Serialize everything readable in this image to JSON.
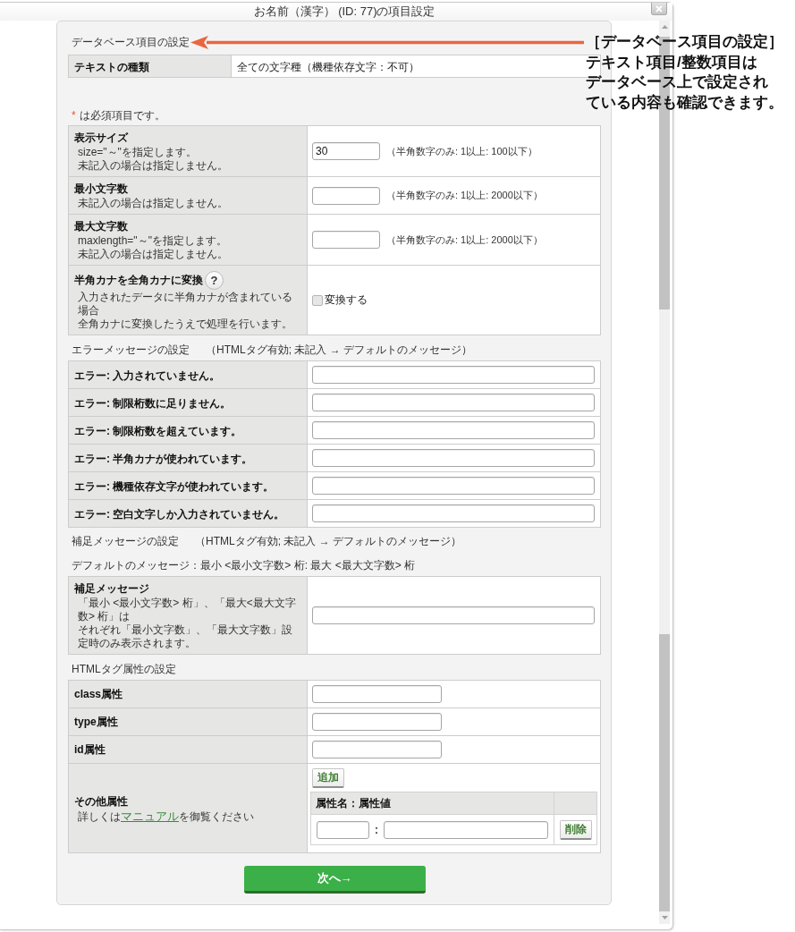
{
  "window": {
    "title": "お名前（漢字） (ID: 77)の項目設定"
  },
  "database_section": {
    "heading": "データベース項目の設定",
    "rows": [
      {
        "label": "テキストの種類",
        "value": "全ての文字種（機種依存文字：不可）"
      }
    ]
  },
  "required_note": {
    "mark": "*",
    "text": "は必須項目です。"
  },
  "size_settings": {
    "rows": [
      {
        "kind": "text",
        "label": "表示サイズ",
        "notes": [
          "size=\"～\"を指定します。",
          "未記入の場合は指定しません。"
        ],
        "value": "30",
        "hint": "（半角数字のみ: 1以上: 100以下）"
      },
      {
        "kind": "text",
        "label": "最小文字数",
        "notes": [
          "未記入の場合は指定しません。"
        ],
        "hint": "（半角数字のみ: 1以上: 2000以下）"
      },
      {
        "kind": "text",
        "label": "最大文字数",
        "notes": [
          "maxlength=\"～\"を指定します。",
          "未記入の場合は指定しません。"
        ],
        "hint": "（半角数字のみ: 1以上: 2000以下）"
      },
      {
        "kind": "checkbox",
        "label": "半角カナを全角カナに変換",
        "help": "?",
        "notes": [
          "入力されたデータに半角カナが含まれている場合",
          "全角カナに変換したうえで処理を行います。"
        ],
        "option": "変換する",
        "checked": false
      }
    ]
  },
  "error_section": {
    "heading": "エラーメッセージの設定",
    "note": "（HTMLタグ有効; 未記入 → デフォルトのメッセージ）",
    "rows": [
      {
        "label": "エラー: 入力されていません。"
      },
      {
        "label": "エラー: 制限桁数に足りません。"
      },
      {
        "label": "エラー: 制限桁数を超えています。"
      },
      {
        "label": "エラー: 半角カナが使われています。"
      },
      {
        "label": "エラー: 機種依存文字が使われています。"
      },
      {
        "label": "エラー: 空白文字しか入力されていません。"
      }
    ]
  },
  "supplement_section": {
    "heading": "補足メッセージの設定",
    "note": "（HTMLタグ有効; 未記入 → デフォルトのメッセージ）",
    "default_message": "デフォルトのメッセージ：最小 <最小文字数> 桁: 最大 <最大文字数> 桁",
    "rows": [
      {
        "label": "補足メッセージ",
        "notes": [
          "「最小 <最小文字数> 桁」、「最大<最大文字数> 桁」は",
          "それぞれ「最小文字数」、「最大文字数」設定時のみ表示されます。"
        ]
      }
    ]
  },
  "html_section": {
    "heading": "HTMLタグ属性の設定",
    "rows": [
      {
        "kind": "text",
        "label": "class属性"
      },
      {
        "kind": "text",
        "label": "type属性"
      },
      {
        "kind": "text",
        "label": "id属性"
      },
      {
        "kind": "attributes",
        "label": "その他属性",
        "note_before": "詳しくは",
        "link": "マニュアル",
        "note_after": "を御覧ください",
        "add_button": "追加",
        "table_header": "属性名：属性値",
        "separator": ":",
        "delete_button": "削除"
      }
    ]
  },
  "next_button": "次へ→",
  "annotation": {
    "title": "［データベース項目の設定］",
    "lines": [
      "テキスト項目/整数項目は",
      "データベース上で設定され",
      "ている内容も確認できます。"
    ]
  }
}
